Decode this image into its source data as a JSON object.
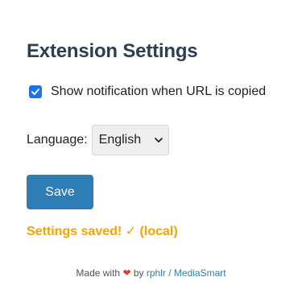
{
  "settings": {
    "title": "Extension Settings",
    "notify_label": "Show notification when URL is copied",
    "notify_checked": true,
    "language_label": "Language:",
    "language_selected": "English",
    "save_label": "Save",
    "status_text": "Settings saved! ✓ (local)"
  },
  "footer": {
    "made_with": "Made with",
    "heart": "❤",
    "by": "by",
    "author_link": "rphlr / MediaSmart"
  },
  "colors": {
    "accent": "#2e7db5",
    "checkbox": "#1a73e8",
    "status": "#f2a500",
    "heart": "#e53935"
  },
  "icons": {
    "checkbox": "checkmark-icon",
    "select": "chevron-down-icon"
  }
}
